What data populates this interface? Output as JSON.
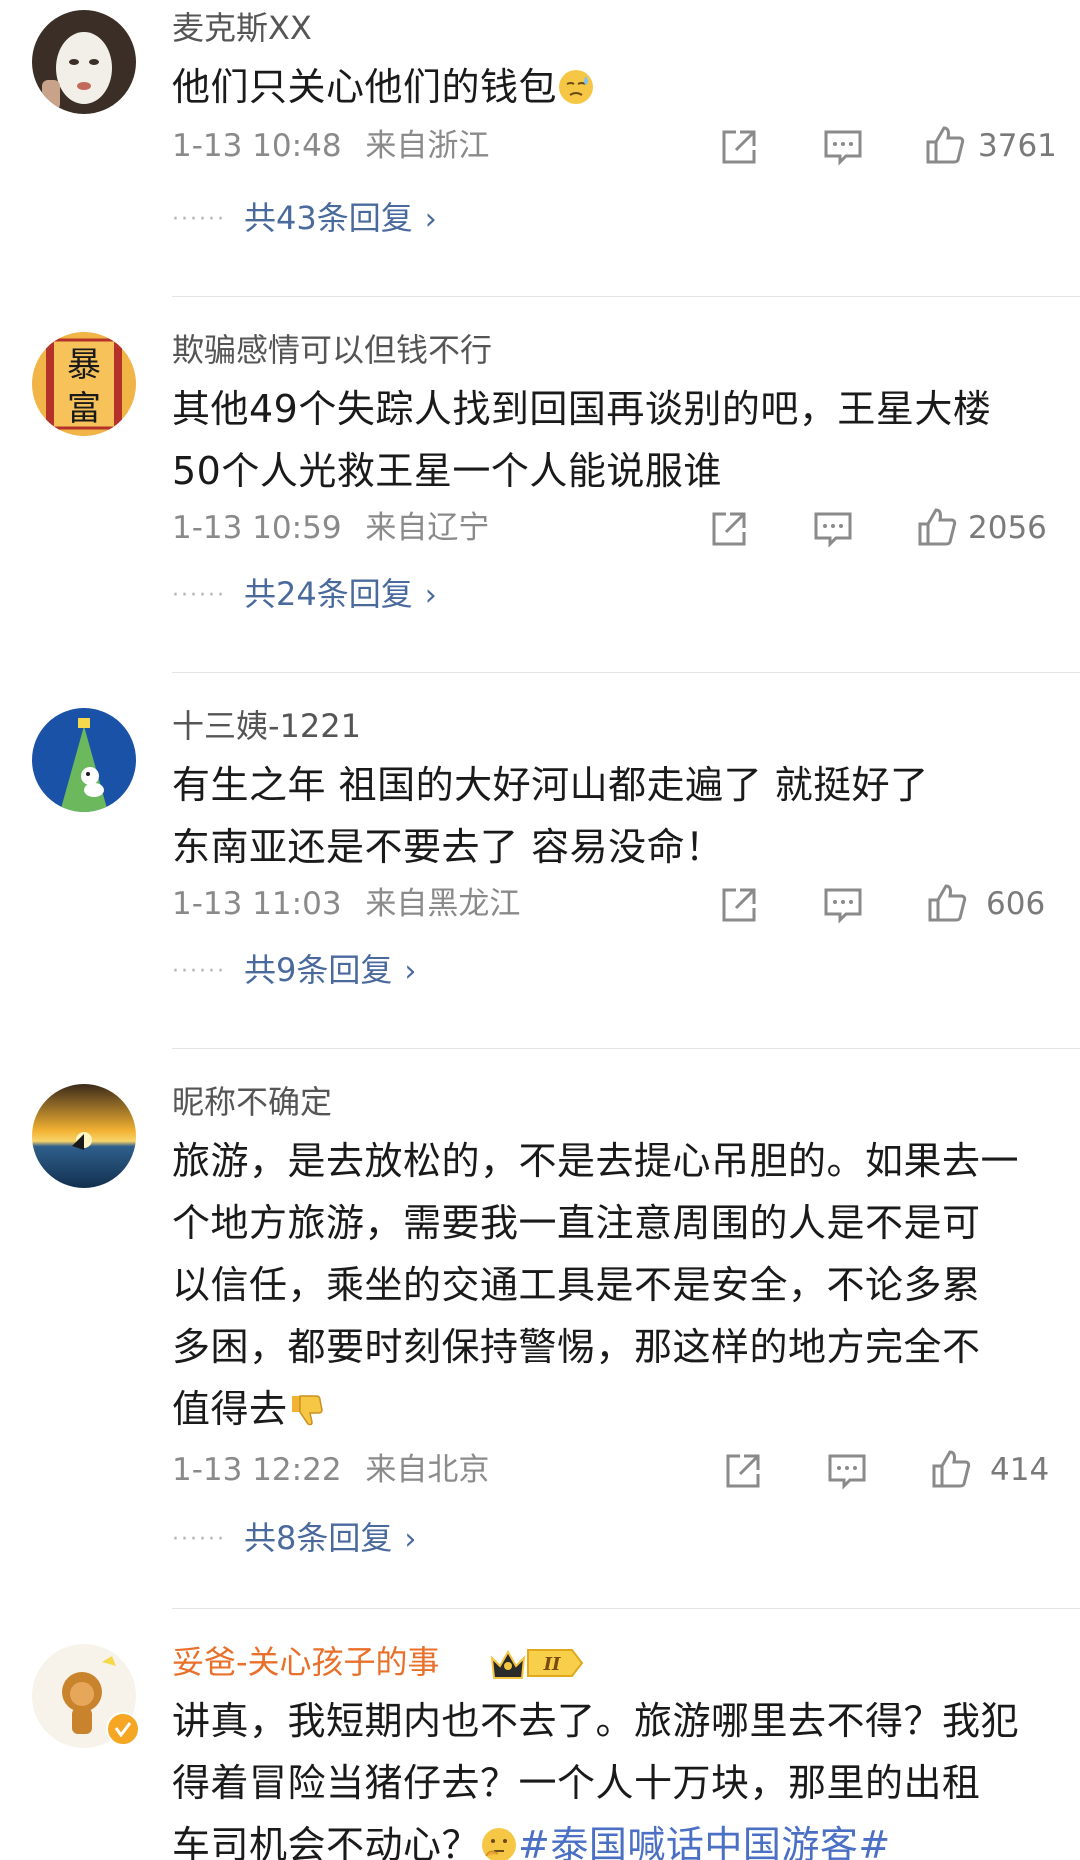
{
  "comments": [
    {
      "username": "麦克斯XX",
      "text": "他们只关心他们的钱包",
      "emoji": "cold-sweat",
      "date": "1-13 10:48",
      "location": "来自浙江",
      "likes": "3761",
      "replies": "共43条回复"
    },
    {
      "username": "欺骗感情可以但钱不行",
      "text_line1": "其他49个失踪人找到回国再谈别的吧，王星大楼",
      "text_line2": "50个人光救王星一个人能说服谁",
      "date": "1-13 10:59",
      "location": "来自辽宁",
      "likes": "2056",
      "replies": "共24条回复",
      "avatar_text_top": "暴",
      "avatar_text_bottom": "富"
    },
    {
      "username": "十三姨-1221",
      "text_line1": "有生之年 祖国的大好河山都走遍了  就挺好了",
      "text_line2": "东南亚还是不要去了 容易没命！",
      "date": "1-13 11:03",
      "location": "来自黑龙江",
      "likes": "606",
      "replies": "共9条回复"
    },
    {
      "username": "昵称不确定",
      "text_line1": "旅游，是去放松的，不是去提心吊胆的。如果去一",
      "text_line2": "个地方旅游，需要我一直注意周围的人是不是可",
      "text_line3": "以信任，乘坐的交通工具是不是安全，不论多累",
      "text_line4": "多困，都要时刻保持警惕，那这样的地方完全不",
      "text_line5": "值得去",
      "emoji": "thumbs-down",
      "date": "1-13 12:22",
      "location": "来自北京",
      "likes": "414",
      "replies": "共8条回复"
    },
    {
      "username": "妥爸-关心孩子的事",
      "badge_level": "II",
      "text_line1": "讲真，我短期内也不去了。旅游哪里去不得？我犯",
      "text_line2": "得着冒险当猪仔去？一个人十万块，那里的出租",
      "text_line3_a": "车司机会不动心？",
      "hashtag": "#泰国喊话中国游客#",
      "emoji": "thinking-face"
    }
  ],
  "colors": {
    "username": "#555555",
    "vip_username": "#e8702a",
    "reply_link": "#4a6a9e",
    "hashtag": "#4a6fc4",
    "meta": "#8a8a8a"
  },
  "icons": [
    "share-icon",
    "comment-icon",
    "like-icon",
    "chevron-right-icon",
    "verified-icon",
    "crown-badge-icon"
  ]
}
